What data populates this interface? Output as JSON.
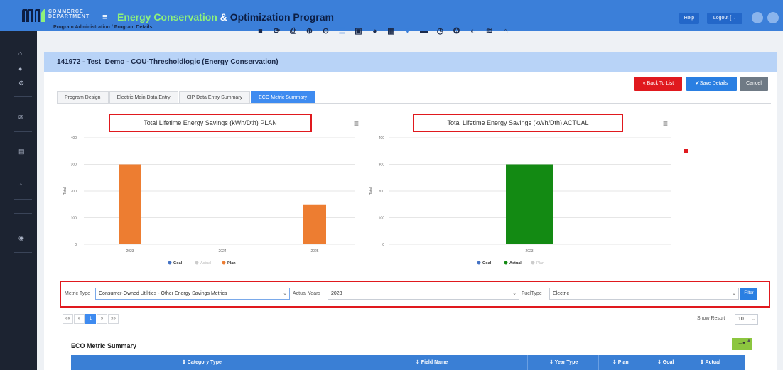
{
  "header": {
    "logo_text_line1": "COMMERCE",
    "logo_text_line2": "DEPARTMENT",
    "title_part1": "Energy Conservation",
    "title_amp": "&",
    "title_part2": "Optimization Program",
    "breadcrumb": "Program Administration / Program Details",
    "help_label": "Help",
    "logout_label": "Logout [→",
    "colors": {
      "topbar": "#3b7fd9",
      "title_green": "#8ff27a"
    }
  },
  "toolbar_icons": [
    "save-icon",
    "refresh-icon",
    "print-icon",
    "zoom-in-icon",
    "zoom-out-icon",
    "list-icon",
    "image-icon",
    "chart-icon",
    "excel-icon",
    "filter-icon",
    "document-icon",
    "clock-icon",
    "settings-icon",
    "info-icon",
    "database-icon",
    "home-icon"
  ],
  "program": {
    "title": "141972 - Test_Demo - COU-Thresholdlogic (Energy Conservation)"
  },
  "actions": {
    "back_label": "« Back To List",
    "save_label": "✔Save Details",
    "cancel_label": "Cancel"
  },
  "tabs": [
    {
      "label": "Program Design",
      "active": false
    },
    {
      "label": "Electric Main Data Entry",
      "active": false
    },
    {
      "label": "CIP Data Entry Summary",
      "active": false
    },
    {
      "label": "ECO Metric Summary",
      "active": true
    }
  ],
  "chart_data": [
    {
      "type": "bar",
      "title": "Total Lifetime Energy Savings (kWh/Dth) PLAN",
      "ylabel": "Total",
      "categories": [
        "2023",
        "2024",
        "2025"
      ],
      "ylim": [
        0,
        400
      ],
      "yticks": [
        "400",
        "300",
        "200",
        "100",
        "0"
      ],
      "series": [
        {
          "name": "Goal",
          "color": "#4472c4",
          "values": [
            0,
            0,
            0
          ],
          "hidden": false
        },
        {
          "name": "Actual",
          "color": "#cccccc",
          "values": [
            0,
            0,
            0
          ],
          "hidden": true
        },
        {
          "name": "Plan",
          "color": "#ed7d31",
          "values": [
            300,
            0,
            150
          ],
          "hidden": false
        }
      ],
      "legend_position": "bottom-center"
    },
    {
      "type": "bar",
      "title": "Total Lifetime Energy Savings (kWh/Dth) ACTUAL",
      "ylabel": "Total",
      "categories": [
        "2023"
      ],
      "ylim": [
        0,
        400
      ],
      "yticks": [
        "400",
        "300",
        "200",
        "100",
        "0"
      ],
      "series": [
        {
          "name": "Goal",
          "color": "#4472c4",
          "values": [
            0
          ],
          "hidden": false
        },
        {
          "name": "Actual",
          "color": "#138a13",
          "values": [
            300
          ],
          "hidden": false
        },
        {
          "name": "Plan",
          "color": "#cccccc",
          "values": [
            0
          ],
          "hidden": true
        }
      ],
      "legend_position": "bottom-center"
    }
  ],
  "filters": {
    "metric_type_label": "Metric Type",
    "metric_type_value": "Consumer-Owned Utilities - Other Energy Savings Metrics",
    "actual_years_label": "Actual Years",
    "actual_years_value": "2023",
    "fuel_type_label": "FuelType",
    "fuel_type_value": "Electric",
    "filter_button": "Filter"
  },
  "pagination": {
    "first": "««",
    "prev": "«",
    "current": "1",
    "next": "»",
    "last": "»»",
    "show_result_label": "Show Result",
    "show_result_value": "10"
  },
  "summary": {
    "title": "ECO Metric Summary",
    "columns_button": "—▾",
    "columns": [
      "⇕ Category Type",
      "⇕ Field Name",
      "⇕ Year Type",
      "⇕ Plan",
      "⇕ Goal",
      "⇕ Actual"
    ]
  }
}
